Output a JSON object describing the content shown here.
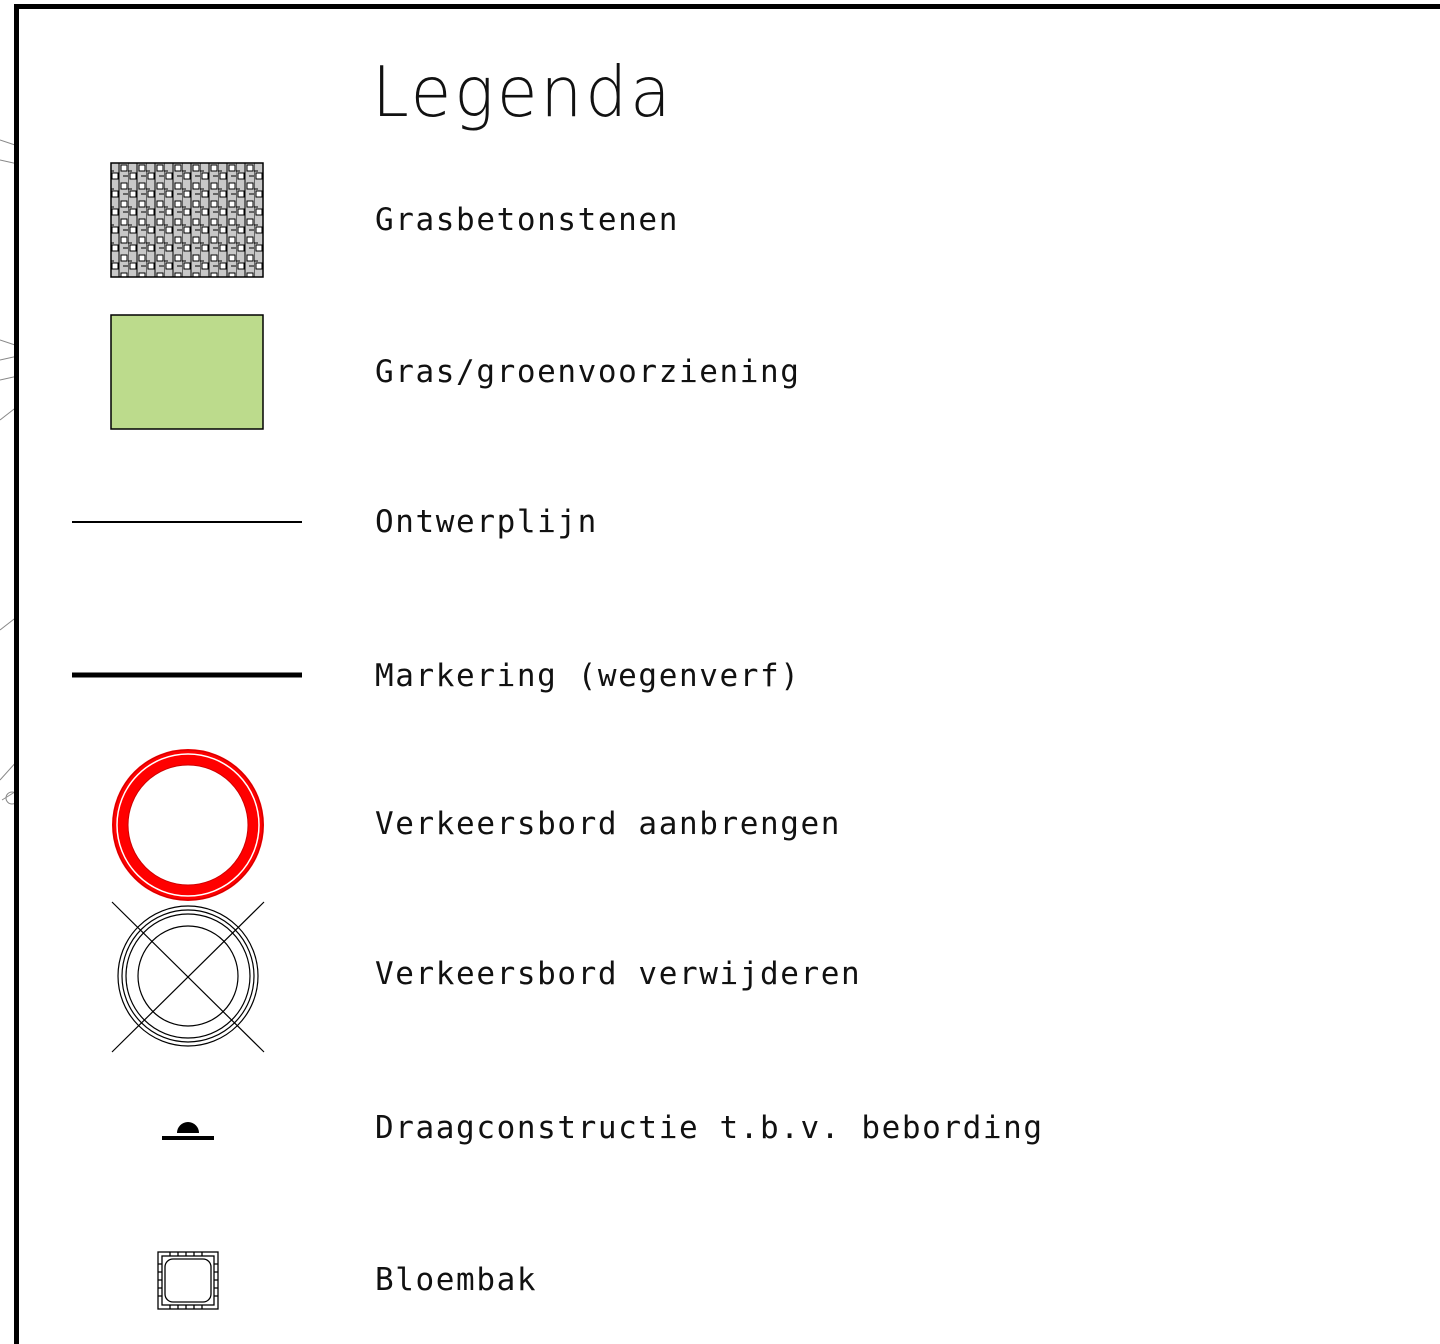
{
  "legend": {
    "title": "Legenda",
    "items": [
      {
        "symbol": "grasbeton-hatch",
        "label": "Grasbetonstenen",
        "color": "#c8c8c8"
      },
      {
        "symbol": "grass-fill",
        "label": "Gras/groenvoorziening",
        "color": "#bcdb8c"
      },
      {
        "symbol": "thin-line",
        "label": "Ontwerplijn"
      },
      {
        "symbol": "thick-line",
        "label": "Markering (wegenverf)"
      },
      {
        "symbol": "red-ring-sign",
        "label": "Verkeersbord aanbrengen",
        "color": "#ff0000"
      },
      {
        "symbol": "crossed-ring-sign",
        "label": "Verkeersbord verwijderen"
      },
      {
        "symbol": "post-support",
        "label": "Draagconstructie t.b.v. bebording"
      },
      {
        "symbol": "planter-box",
        "label": "Bloembak"
      }
    ]
  }
}
